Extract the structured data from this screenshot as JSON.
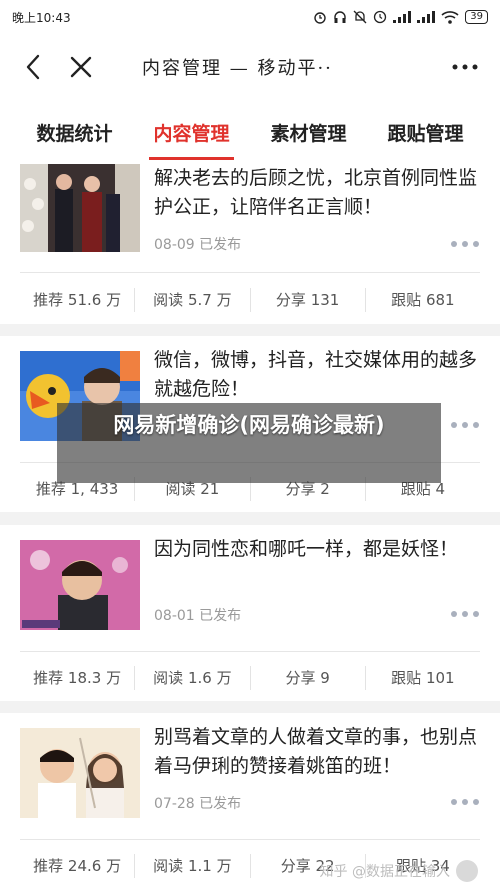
{
  "status_bar": {
    "time": "晚上10:43",
    "battery": "39"
  },
  "title_bar": {
    "title": "内容管理 — 移动平··"
  },
  "tabs": [
    {
      "label": "数据统计",
      "active": false
    },
    {
      "label": "内容管理",
      "active": true
    },
    {
      "label": "素材管理",
      "active": false
    },
    {
      "label": "跟贴管理",
      "active": false
    }
  ],
  "cards": [
    {
      "headline": "解决老去的后顾之忧，北京首例同性监护公正，让陪伴名正言顺！",
      "date_status": "08-09 已发布",
      "stats": {
        "recommend": "推荐 51.6 万",
        "read": "阅读 5.7 万",
        "share": "分享 131",
        "comments": "跟贴 681"
      }
    },
    {
      "headline": "微信，微博，抖音，社交媒体用的越多就越危险！",
      "date_status": "",
      "stats": {
        "recommend": "推荐 1, 433",
        "read": "阅读 21",
        "share": "分享 2",
        "comments": "跟贴 4"
      }
    },
    {
      "headline": "因为同性恋和哪吒一样，都是妖怪！",
      "date_status": "08-01 已发布",
      "stats": {
        "recommend": "推荐 18.3 万",
        "read": "阅读 1.6 万",
        "share": "分享 9",
        "comments": "跟贴 101"
      }
    },
    {
      "headline": "别骂着文章的人做着文章的事，也别点着马伊琍的赞接着姚笛的班！",
      "date_status": "07-28 已发布",
      "stats": {
        "recommend": "推荐 24.6 万",
        "read": "阅读 1.1 万",
        "share": "分享 22",
        "comments": "跟贴 34"
      }
    }
  ],
  "overlay": {
    "text": "网易新增确诊(网易确诊最新)"
  },
  "watermark": {
    "text": "知乎 @数据正在输入"
  },
  "colors": {
    "accent": "#e0322c",
    "background": "#f2f2f2",
    "card": "#ffffff"
  }
}
